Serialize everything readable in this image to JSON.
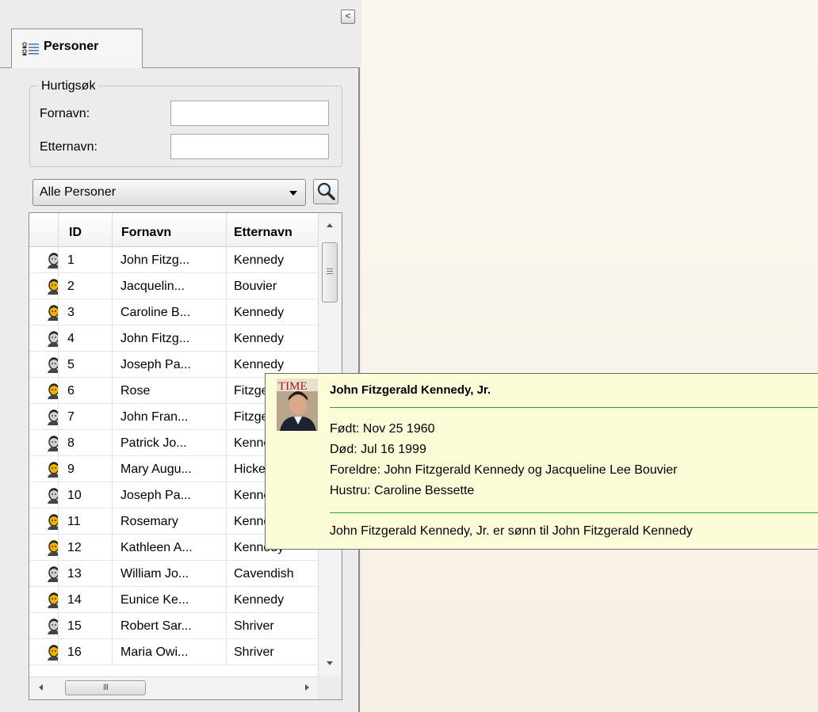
{
  "panel": {
    "collapse_symbol": "<",
    "tab": {
      "label": "Personer",
      "icon": "person-list-icon"
    }
  },
  "quick_search": {
    "legend": "Hurtigsøk",
    "first_name_label": "Fornavn:",
    "first_name_value": "",
    "last_name_label": "Etternavn:",
    "last_name_value": ""
  },
  "filter": {
    "selected": "Alle Personer",
    "search_icon": "magnifier-icon"
  },
  "table": {
    "headers": [
      "ID",
      "Fornavn",
      "Etternavn"
    ],
    "rows": [
      {
        "id": "1",
        "first": "John Fitzg...",
        "last": "Kennedy",
        "gender": "male"
      },
      {
        "id": "2",
        "first": "Jacquelin...",
        "last": "Bouvier",
        "gender": "female"
      },
      {
        "id": "3",
        "first": "Caroline B...",
        "last": "Kennedy",
        "gender": "female"
      },
      {
        "id": "4",
        "first": "John Fitzg...",
        "last": "Kennedy",
        "gender": "male"
      },
      {
        "id": "5",
        "first": "Joseph Pa...",
        "last": "Kennedy",
        "gender": "male"
      },
      {
        "id": "6",
        "first": "Rose",
        "last": "Fitzgerald",
        "gender": "female"
      },
      {
        "id": "7",
        "first": "John Fran...",
        "last": "Fitzgerald",
        "gender": "male"
      },
      {
        "id": "8",
        "first": "Patrick Jo...",
        "last": "Kennedy",
        "gender": "male"
      },
      {
        "id": "9",
        "first": "Mary Augu...",
        "last": "Hickey",
        "gender": "female"
      },
      {
        "id": "10",
        "first": "Joseph Pa...",
        "last": "Kennedy",
        "gender": "male"
      },
      {
        "id": "11",
        "first": "Rosemary",
        "last": "Kennedy",
        "gender": "female"
      },
      {
        "id": "12",
        "first": "Kathleen A...",
        "last": "Kennedy",
        "gender": "female"
      },
      {
        "id": "13",
        "first": "William Jo...",
        "last": "Cavendish",
        "gender": "male"
      },
      {
        "id": "14",
        "first": "Eunice Ke...",
        "last": "Kennedy",
        "gender": "female"
      },
      {
        "id": "15",
        "first": "Robert Sar...",
        "last": "Shriver",
        "gender": "male"
      },
      {
        "id": "16",
        "first": "Maria Owi...",
        "last": "Shriver",
        "gender": "female"
      }
    ],
    "hscroll_grip": "III"
  },
  "tooltip": {
    "photo_text": "TIME",
    "title": "John Fitzgerald Kennedy, Jr.",
    "born": "Født: Nov 25 1960",
    "died": "Død: Jul 16 1999",
    "parents": "Foreldre: John Fitzgerald Kennedy og Jacqueline Lee Bouvier",
    "spouse": "Hustru: Caroline Bessette",
    "summary": "John Fitzgerald Kennedy, Jr. er sønn til John Fitzgerald Kennedy"
  },
  "colors": {
    "panel_bg": "#ececec",
    "tooltip_bg": "#fcfcd9",
    "tooltip_rule": "#2fa12f",
    "icon_male_face": "#cfcfcf",
    "icon_female_face": "#f0b000"
  }
}
